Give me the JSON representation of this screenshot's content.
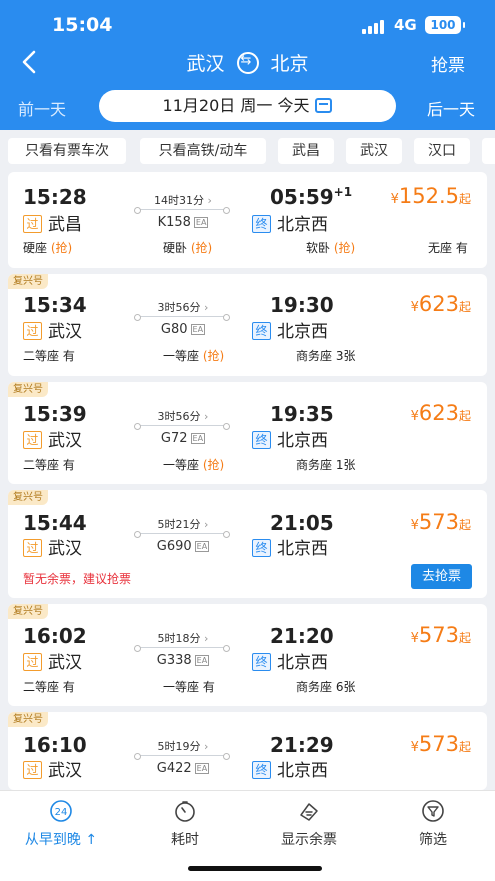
{
  "status_bar": {
    "time": "15:04",
    "network": "4G",
    "battery": "100"
  },
  "nav": {
    "from": "武汉",
    "to": "北京",
    "action": "抢票"
  },
  "date_row": {
    "prev": "前一天",
    "date": "11月20日 周一 今天",
    "next": "后一天"
  },
  "filters": [
    "只看有票车次",
    "只看高铁/动车",
    "武昌",
    "武汉",
    "汉口"
  ],
  "colors": {
    "primary": "#2a8cef",
    "price": "#f57c16",
    "warning": "#e8323c"
  },
  "trains": [
    {
      "badge": "",
      "dep_time": "15:28",
      "dep_tag": "过",
      "dep_station": "武昌",
      "duration": "14时31分",
      "train_no": "K158",
      "arr_time": "05:59",
      "arr_plus": "+1",
      "arr_tag": "终",
      "arr_station": "北京西",
      "price_currency": "¥",
      "price_value": "152.5",
      "price_suffix": "起",
      "seats": [
        {
          "name": "硬座",
          "status": "(抢)"
        },
        {
          "name": "硬卧",
          "status": "(抢)"
        },
        {
          "name": "软卧",
          "status": "(抢)"
        },
        {
          "name": "无座",
          "status": "有"
        }
      ]
    },
    {
      "badge": "复兴号",
      "dep_time": "15:34",
      "dep_tag": "过",
      "dep_station": "武汉",
      "duration": "3时56分",
      "train_no": "G80",
      "arr_time": "19:30",
      "arr_plus": "",
      "arr_tag": "终",
      "arr_station": "北京西",
      "price_currency": "¥",
      "price_value": "623",
      "price_suffix": "起",
      "seats": [
        {
          "name": "二等座",
          "status": "有"
        },
        {
          "name": "一等座",
          "status": "(抢)"
        },
        {
          "name": "商务座",
          "status": "3张"
        }
      ]
    },
    {
      "badge": "复兴号",
      "dep_time": "15:39",
      "dep_tag": "过",
      "dep_station": "武汉",
      "duration": "3时56分",
      "train_no": "G72",
      "arr_time": "19:35",
      "arr_plus": "",
      "arr_tag": "终",
      "arr_station": "北京西",
      "price_currency": "¥",
      "price_value": "623",
      "price_suffix": "起",
      "seats": [
        {
          "name": "二等座",
          "status": "有"
        },
        {
          "name": "一等座",
          "status": "(抢)"
        },
        {
          "name": "商务座",
          "status": "1张"
        }
      ]
    },
    {
      "badge": "复兴号",
      "dep_time": "15:44",
      "dep_tag": "过",
      "dep_station": "武汉",
      "duration": "5时21分",
      "train_no": "G690",
      "arr_time": "21:05",
      "arr_plus": "",
      "arr_tag": "终",
      "arr_station": "北京西",
      "price_currency": "¥",
      "price_value": "573",
      "price_suffix": "起",
      "warning": "暂无余票，建议抢票",
      "button": "去抢票"
    },
    {
      "badge": "复兴号",
      "dep_time": "16:02",
      "dep_tag": "过",
      "dep_station": "武汉",
      "duration": "5时18分",
      "train_no": "G338",
      "arr_time": "21:20",
      "arr_plus": "",
      "arr_tag": "终",
      "arr_station": "北京西",
      "price_currency": "¥",
      "price_value": "573",
      "price_suffix": "起",
      "seats": [
        {
          "name": "二等座",
          "status": "有"
        },
        {
          "name": "一等座",
          "status": "有"
        },
        {
          "name": "商务座",
          "status": "6张"
        }
      ]
    },
    {
      "badge": "复兴号",
      "dep_time": "16:10",
      "dep_tag": "过",
      "dep_station": "武汉",
      "duration": "5时19分",
      "train_no": "G422",
      "arr_time": "21:29",
      "arr_plus": "",
      "arr_tag": "终",
      "arr_station": "北京西",
      "price_currency": "¥",
      "price_value": "573",
      "price_suffix": "起"
    }
  ],
  "tabs": [
    {
      "label": "从早到晚",
      "icon": "clock-24-icon",
      "active": true
    },
    {
      "label": "耗时",
      "icon": "stopwatch-icon",
      "active": false
    },
    {
      "label": "显示余票",
      "icon": "ticket-icon",
      "active": false
    },
    {
      "label": "筛选",
      "icon": "filter-icon",
      "active": false
    }
  ]
}
